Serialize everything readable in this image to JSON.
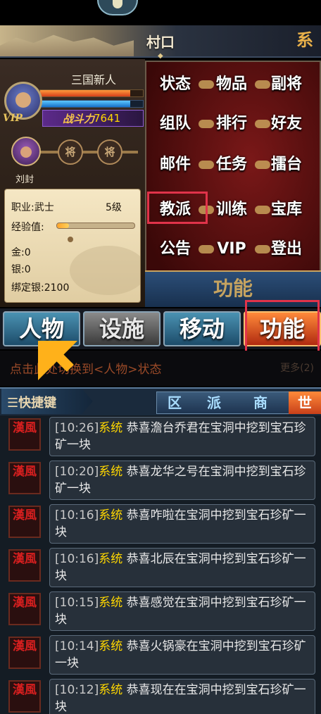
{
  "header": {
    "title": "村口",
    "right_glyph": "系"
  },
  "player": {
    "name": "三国新人",
    "vip_label": "VIP",
    "power_label": "战斗力",
    "power_value": "7641",
    "hp_fraction": 0.88,
    "mp_fraction": 0.88
  },
  "general": {
    "name": "刘封",
    "slot_labels": [
      "将",
      "将"
    ]
  },
  "stats": {
    "job": "职业:武士",
    "level": "5级",
    "exp_label": "经验值:",
    "exp_fraction": 0.15,
    "gold": "金:0",
    "silver": "银:0",
    "bound_silver": "绑定银:2100"
  },
  "functions": {
    "buttons": [
      "状态",
      "物品",
      "副将",
      "组队",
      "排行",
      "好友",
      "邮件",
      "任务",
      "擂台",
      "教派",
      "训练",
      "宝库",
      "公告",
      "VIP",
      "登出"
    ],
    "footer_label": "功能"
  },
  "tabs": [
    "人物",
    "设施",
    "移动",
    "功能"
  ],
  "hint": {
    "text": "点击此处切换到<人物>状态",
    "more": "更多(2)"
  },
  "chat": {
    "title": "快捷键",
    "tabs": [
      "区",
      "派",
      "商",
      "世"
    ],
    "icon_label": "漢風",
    "messages": [
      {
        "time": "[10:26]",
        "tag": "系统",
        "text": " 恭喜澹台乔君在宝洞中挖到宝石珍矿一块"
      },
      {
        "time": "[10:20]",
        "tag": "系统",
        "text": " 恭喜龙华之号在宝洞中挖到宝石珍矿一块"
      },
      {
        "time": "[10:16]",
        "tag": "系统",
        "text": " 恭喜咋啦在宝洞中挖到宝石珍矿一块"
      },
      {
        "time": "[10:16]",
        "tag": "系统",
        "text": " 恭喜北辰在宝洞中挖到宝石珍矿一块"
      },
      {
        "time": "[10:15]",
        "tag": "系统",
        "text": " 恭喜感觉在宝洞中挖到宝石珍矿一块"
      },
      {
        "time": "[10:14]",
        "tag": "系统",
        "text": " 恭喜火锅豪在宝洞中挖到宝石珍矿一块"
      },
      {
        "time": "[10:12]",
        "tag": "系统",
        "text": " 恭喜现在在宝洞中挖到宝石珍矿一块"
      }
    ]
  }
}
